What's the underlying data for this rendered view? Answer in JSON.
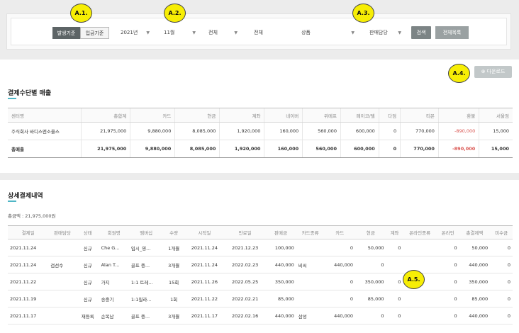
{
  "filters": {
    "toggle_issue": "발생기준",
    "toggle_deposit": "입금기준",
    "year": "2021년",
    "month": "11월",
    "all1": "전체",
    "all2": "전체",
    "product": "상품",
    "manager": "판매담당",
    "search": "검색",
    "all_list": "전체목록"
  },
  "markers": {
    "a1": "A.1.",
    "a2": "A.2.",
    "a3": "A.3.",
    "a4": "A.4.",
    "a5": "A.5."
  },
  "download": {
    "label": "다운로드"
  },
  "summary": {
    "title": "결제수단별 매출",
    "headers": [
      "센터명",
      "총합계",
      "카드",
      "현금",
      "계좌",
      "네이버",
      "위메프",
      "페이코/텔",
      "다점",
      "티몬",
      "환불",
      "서울점"
    ],
    "rows": [
      [
        "주식회사 바디스엔소울스",
        "21,975,000",
        "9,880,000",
        "8,085,000",
        "1,920,000",
        "160,000",
        "560,000",
        "600,000",
        "0",
        "770,000",
        "-890,000",
        "15,000"
      ],
      [
        "총매출",
        "21,975,000",
        "9,880,000",
        "8,085,000",
        "1,920,000",
        "160,000",
        "560,000",
        "600,000",
        "0",
        "770,000",
        "-890,000",
        "15,000"
      ]
    ]
  },
  "detail": {
    "title": "상세결제내역",
    "total_amount": "총금액 : 21,975,000원",
    "headers": [
      "결제일",
      "판매담당",
      "상태",
      "회원명",
      "멤버십",
      "수량",
      "시작일",
      "만료일",
      "판매금",
      "카드종류",
      "카드",
      "현금",
      "계좌",
      "온라인종류",
      "온라인",
      "총결제액",
      "미수금"
    ],
    "rows": [
      [
        "2021.11.24",
        "",
        "신규",
        "Che G...",
        "입시_영...",
        "1개월",
        "2021.11.24",
        "2021.12.23",
        "100,000",
        "",
        "0",
        "50,000",
        "0",
        "",
        "0",
        "50,000",
        "0"
      ],
      [
        "2021.11.24",
        "검선수",
        "신규",
        "Alan T...",
        "골프 중...",
        "3개월",
        "2021.11.24",
        "2022.02.23",
        "440,000",
        "비씨",
        "440,000",
        "0",
        "",
        "",
        "0",
        "440,000",
        "0"
      ],
      [
        "2021.11.22",
        "",
        "신규",
        "가지",
        "1:1 트레...",
        "15회",
        "2021.11.26",
        "2022.05.25",
        "350,000",
        "",
        "0",
        "350,000",
        "0",
        "",
        "0",
        "350,000",
        "0"
      ],
      [
        "2021.11.19",
        "",
        "신규",
        "송중기",
        "1:1필라...",
        "1회",
        "2021.11.22",
        "2022.02.21",
        "85,000",
        "",
        "0",
        "85,000",
        "0",
        "",
        "0",
        "85,000",
        "0"
      ],
      [
        "2021.11.17",
        "",
        "재등록",
        "손목남",
        "골프 중...",
        "3개월",
        "2021.11.17",
        "2022.02.16",
        "440,000",
        "삼성",
        "440,000",
        "0",
        "0",
        "",
        "0",
        "440,000",
        "0"
      ]
    ]
  }
}
